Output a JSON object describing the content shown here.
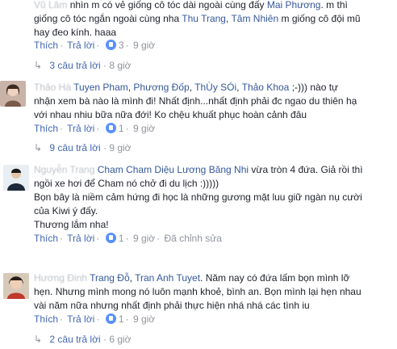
{
  "comments": [
    {
      "line1_hidden": "Vũ Lâm",
      "line1": "nhìn m có vẻ giống cô tóc dài ngoài cùng đấy",
      "tag1": "Mai Phương",
      "line1_end": ". m thì",
      "line2": "giống cô tóc ngắn ngoài cùng nha",
      "tag2": "Thu Trang",
      "sep2": ",",
      "tag3": "Tâm Nhiên",
      "line2_end": "m giống cô đội mũ",
      "line3": "hay đeo kính. haaa",
      "like": "Thích",
      "reply": "Trả lời",
      "count": "3",
      "time": "9 giờ",
      "replies_label": "3 câu trả lời",
      "replies_time": "8 giờ"
    },
    {
      "name_hidden": "Thảo Hà",
      "tags": [
        "Tuyen Pham",
        "Phương Đốp",
        "ThÙy SÓi",
        "Thảo Khoa"
      ],
      "tags_end": ";-))) nào tự",
      "line2": "nhận xem bà nào là mình đi! Nhất định...nhất định phải đc ngao du thiên hạ",
      "line3": "với nhau nhiu bữa nữa đới! Ko chệu khuất phục hoàn cảnh đâu",
      "like": "Thích",
      "reply": "Trả lời",
      "count": "1",
      "time": "9 giờ",
      "replies_label": "9 câu trả lời",
      "replies_time": "9 giờ"
    },
    {
      "name_hidden": "Nguyễn Trang",
      "name": "Cham Cham Diệu Lương Băng Nhi",
      "line1_end": "vừa tròn 4 đứa. Giả rồi thì",
      "line2": "ngồi xe hơi để Cham nó chở đi du lịch :)))))",
      "line3": "Bọn bây là niềm cảm hứng đi học là những gương mặt luu giữ ngàn nụ cười",
      "line4": "của Kiwi ý đấy.",
      "line5": "Thương lắm nha!",
      "like": "Thích",
      "reply": "Trả lời",
      "count": "1",
      "time": "9 giờ",
      "edited": "Đã chỉnh sửa"
    },
    {
      "name_hidden": "Hương Đinh",
      "tags": [
        "Trang Đỗ",
        "Tran Anh Tuyet"
      ],
      "line1_end": ". Năm nay có đứa lấm bọn mình lỡ",
      "line2": "hẹn. Nhưng mình mong nó luôn mạnh khoẻ, bình an. Bọn mình lại hẹn nhau",
      "line3": "vài năm nữa nhưng nhất định phải thực hiện nhá nhá các tình iu",
      "like": "Thích",
      "reply": "Trả lời",
      "count": "1",
      "time": "9 giờ",
      "replies_label": "2 câu trả lời",
      "replies_time": "6 giờ"
    }
  ],
  "colors": {
    "link": "#365899",
    "action": "#4267b2",
    "meta": "#90949c",
    "text": "#1d2129"
  }
}
